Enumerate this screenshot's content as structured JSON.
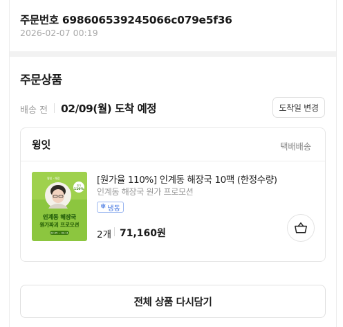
{
  "order": {
    "number": "주문번호 698606539245066c079e5f36",
    "datetime": "2026-02-07 00:19"
  },
  "section": {
    "title": "주문상품"
  },
  "shipping": {
    "status": "배송 전",
    "eta": "02/09(월) 도착 예정",
    "change_label": "도착일 변경"
  },
  "package": {
    "seller": "윙잇",
    "method": "택배배송",
    "item": {
      "name": "[원가율 110%] 인계동 해장국 10팩 (한정수량)",
      "option": "인계동 해장국 원가 프로모션",
      "tag": "냉동",
      "quantity": "2개",
      "price": "71,160원",
      "thumb": {
        "bg_color": "#8cc63f",
        "title_line1": "인계동 해장국",
        "title_line2": "원가파괴 프로모션",
        "badge_top": "원가",
        "badge_value": "110%",
        "caption": "02.05 ~ 02.11"
      }
    }
  },
  "actions": {
    "reorder_label": "전체 상품 다시담기"
  },
  "icons": {
    "tag": "snowflake-icon",
    "cart": "basket-icon"
  }
}
